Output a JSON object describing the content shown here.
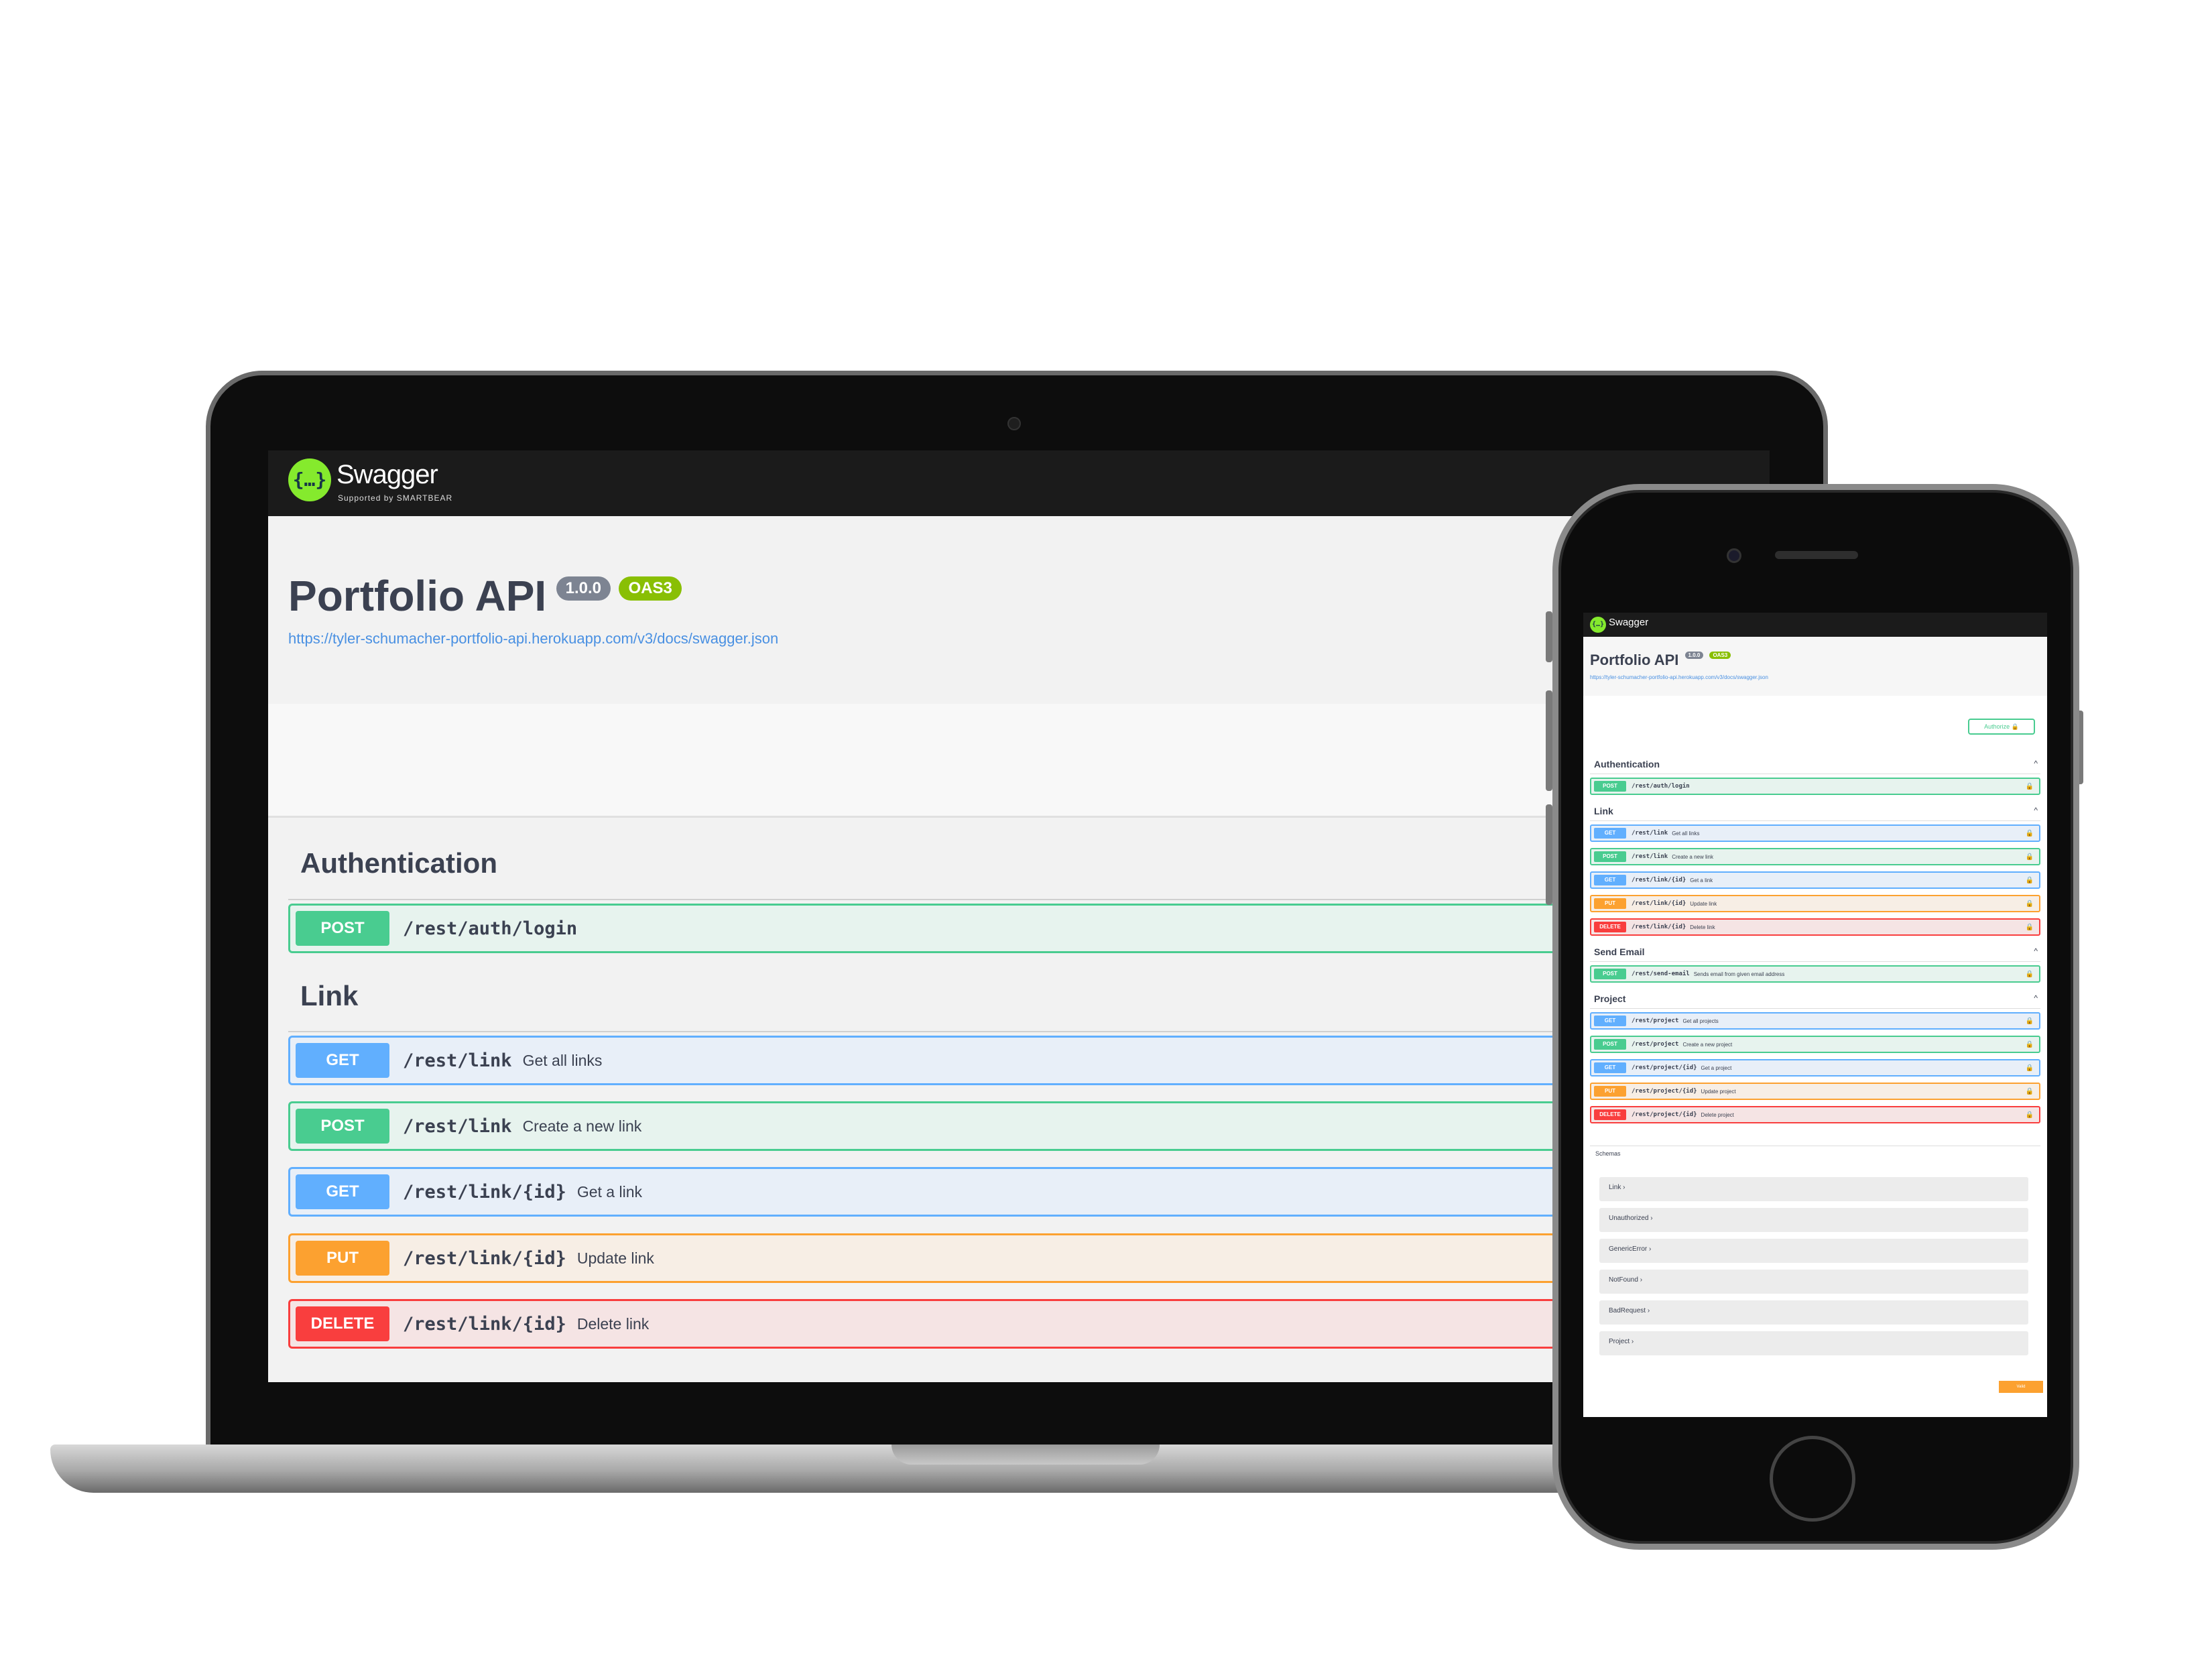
{
  "desktop": {
    "brand": "Swagger",
    "brand_sub": "Supported by SMARTBEAR",
    "logo_glyph": "{…}",
    "title": "Portfolio API",
    "version": "1.0.0",
    "oas": "OAS3",
    "spec_url": "https://tyler-schumacher-portfolio-api.herokuapp.com/v3/docs/swagger.json",
    "tags": {
      "auth": "Authentication",
      "link": "Link"
    },
    "ops": [
      {
        "method": "POST",
        "path": "/rest/auth/login",
        "desc": ""
      },
      {
        "method": "GET",
        "path": "/rest/link",
        "desc": "Get all links"
      },
      {
        "method": "POST",
        "path": "/rest/link",
        "desc": "Create a new link"
      },
      {
        "method": "GET",
        "path": "/rest/link/{id}",
        "desc": "Get a link"
      },
      {
        "method": "PUT",
        "path": "/rest/link/{id}",
        "desc": "Update link"
      },
      {
        "method": "DELETE",
        "path": "/rest/link/{id}",
        "desc": "Delete link"
      }
    ]
  },
  "mobile": {
    "brand": "Swagger",
    "logo_glyph": "{…}",
    "title": "Portfolio API",
    "version": "1.0.0",
    "oas": "OAS3",
    "spec_url": "https://tyler-schumacher-portfolio-api.herokuapp.com/v3/docs/swagger.json",
    "authorize": "Authorize",
    "lock_icon": "🔒",
    "chevron": "⌄",
    "caret_up": "^",
    "tags": {
      "auth": "Authentication",
      "link": "Link",
      "email": "Send Email",
      "project": "Project"
    },
    "ops": [
      {
        "method": "POST",
        "path": "/rest/auth/login",
        "desc": ""
      },
      {
        "method": "GET",
        "path": "/rest/link",
        "desc": "Get all links"
      },
      {
        "method": "POST",
        "path": "/rest/link",
        "desc": "Create a new link"
      },
      {
        "method": "GET",
        "path": "/rest/link/{id}",
        "desc": "Get a link"
      },
      {
        "method": "PUT",
        "path": "/rest/link/{id}",
        "desc": "Update link"
      },
      {
        "method": "DELETE",
        "path": "/rest/link/{id}",
        "desc": "Delete link"
      },
      {
        "method": "POST",
        "path": "/rest/send-email",
        "desc": "Sends email from given email address"
      },
      {
        "method": "GET",
        "path": "/rest/project",
        "desc": "Get all projects"
      },
      {
        "method": "POST",
        "path": "/rest/project",
        "desc": "Create a new project"
      },
      {
        "method": "GET",
        "path": "/rest/project/{id}",
        "desc": "Get a project"
      },
      {
        "method": "PUT",
        "path": "/rest/project/{id}",
        "desc": "Update project"
      },
      {
        "method": "DELETE",
        "path": "/rest/project/{id}",
        "desc": "Delete project"
      }
    ],
    "schemas_label": "Schemas",
    "schemas": [
      {
        "name": "Link",
        "arrow": "›"
      },
      {
        "name": "Unauthorized",
        "arrow": "›"
      },
      {
        "name": "GenericError",
        "arrow": "›"
      },
      {
        "name": "NotFound",
        "arrow": "›"
      },
      {
        "name": "BadRequest",
        "arrow": "›"
      },
      {
        "name": "Project",
        "arrow": "›"
      }
    ],
    "validator": "Valid"
  },
  "colors": {
    "post": "#49cc90",
    "get": "#61affe",
    "put": "#fca130",
    "delete": "#f93e3e",
    "swagger_green": "#85ea2d",
    "topbar": "#1b1b1b"
  }
}
